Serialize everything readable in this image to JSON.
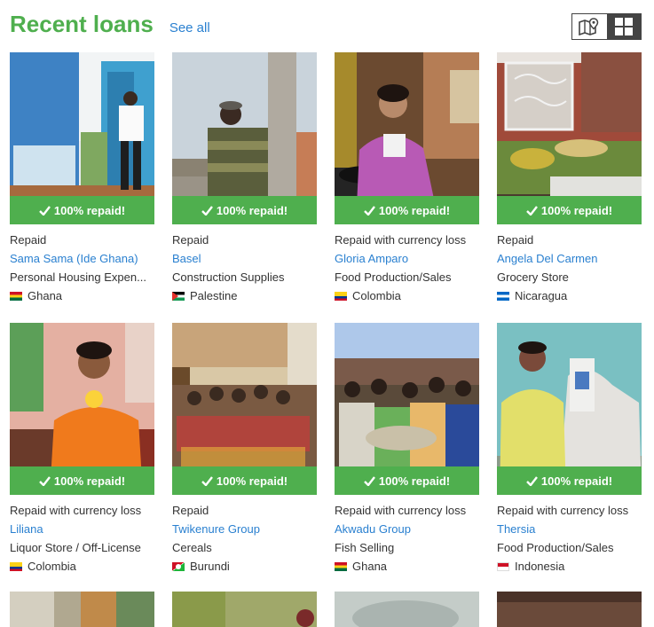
{
  "header": {
    "title": "Recent loans",
    "see_all": "See all"
  },
  "view_toggle": {
    "map_icon": "map-pin-icon",
    "grid_icon": "grid-icon"
  },
  "repaid_label": "100% repaid!",
  "loans": [
    {
      "status": "Repaid",
      "name": "Sama Sama (Ide Ghana)",
      "sector": "Personal Housing Expen...",
      "country": "Ghana"
    },
    {
      "status": "Repaid",
      "name": "Basel",
      "sector": "Construction Supplies",
      "country": "Palestine"
    },
    {
      "status": "Repaid with currency loss",
      "name": "Gloria Amparo",
      "sector": "Food Production/Sales",
      "country": "Colombia"
    },
    {
      "status": "Repaid",
      "name": "Angela Del Carmen",
      "sector": "Grocery Store",
      "country": "Nicaragua"
    },
    {
      "status": "Repaid with currency loss",
      "name": "Liliana",
      "sector": "Liquor Store / Off-License",
      "country": "Colombia"
    },
    {
      "status": "Repaid",
      "name": "Twikenure Group",
      "sector": "Cereals",
      "country": "Burundi"
    },
    {
      "status": "Repaid with currency loss",
      "name": "Akwadu Group",
      "sector": "Fish Selling",
      "country": "Ghana"
    },
    {
      "status": "Repaid with currency loss",
      "name": "Thersia",
      "sector": "Food Production/Sales",
      "country": "Indonesia"
    }
  ]
}
